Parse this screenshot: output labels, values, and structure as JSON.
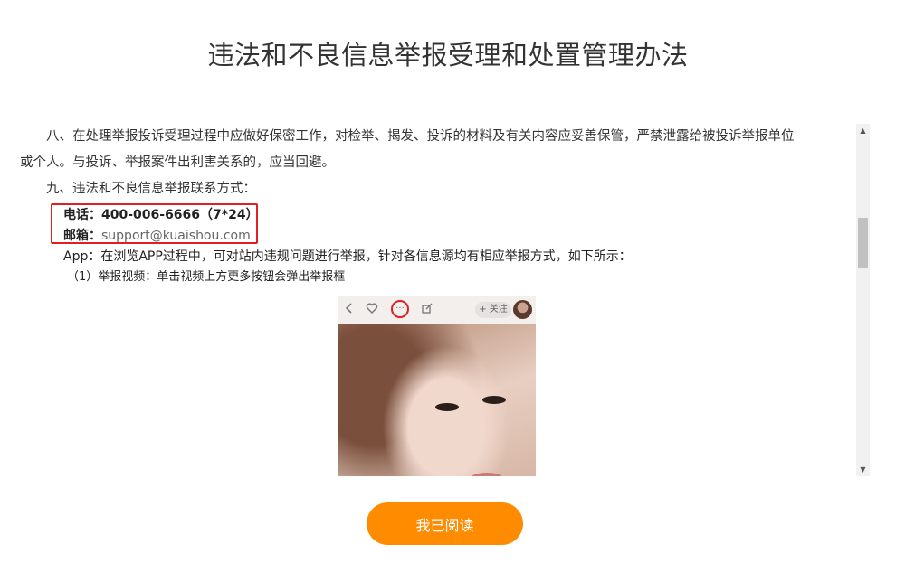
{
  "page": {
    "title": "违法和不良信息举报受理和处置管理办法"
  },
  "content": {
    "para8_line1": "八、在处理举报投诉受理过程中应做好保密工作，对检举、揭发、投诉的材料及有关内容应妥善保管，严禁泄露给被投诉举报单位",
    "para8_line2": "或个人。与投诉、举报案件出利害关系的，应当回避。",
    "para9_heading": "九、违法和不良信息举报联系方式：",
    "phone_label": "电话：",
    "phone_value": "400-006-6666（7*24）",
    "email_label": "邮箱：",
    "email_value": "support@kuaishou.com",
    "app_line": "App：在浏览APP过程中，可对站内违规问题进行举报，针对各信息源均有相应举报方式，如下所示：",
    "step_1": "（1）举报视频：单击视频上方更多按钮会弹出举报框"
  },
  "screenshot": {
    "back_icon": "chevron-left-icon",
    "like_icon": "heart-icon",
    "more_icon": "more-dots-icon",
    "share_icon": "share-edit-icon",
    "follow_label": "+ 关注",
    "highlight_color": "#e02020"
  },
  "actions": {
    "read_button": "我已阅读"
  },
  "colors": {
    "accent": "#ff8c00",
    "highlight": "#e02020"
  }
}
